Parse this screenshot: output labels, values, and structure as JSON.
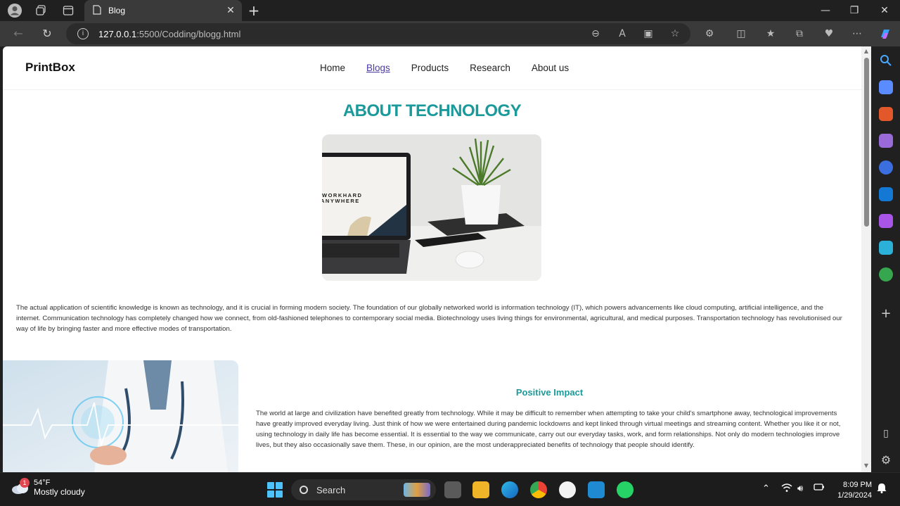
{
  "browser": {
    "tab_title": "Blog",
    "url_host": "127.0.0.1",
    "url_rest": ":5500/Codding/blogg.html"
  },
  "site": {
    "logo": "PrintBox",
    "nav": [
      {
        "label": "Home",
        "active": false
      },
      {
        "label": "Blogs",
        "active": true
      },
      {
        "label": "Products",
        "active": false
      },
      {
        "label": "Research",
        "active": false
      },
      {
        "label": "About us",
        "active": false
      }
    ],
    "title": "ABOUT TECHNOLOGY",
    "hero_image_text": [
      "WORKHARD",
      "ANYWHERE"
    ],
    "intro": "The actual application of scientific knowledge is known as technology, and it is crucial in forming modern society. The foundation of our globally networked world is information technology (IT), which powers advancements like cloud computing, artificial intelligence, and the internet. Communication technology has completely changed how we connect, from old-fashioned telephones to contemporary social media. Biotechnology uses living things for environmental, agricultural, and medical purposes. Transportation technology has revolutionised our way of life by bringing faster and more effective modes of transportation.",
    "section": {
      "title": "Positive Impact",
      "text": "The world at large and civilization have benefited greatly from technology. While it may be difficult to remember when attempting to take your child's smartphone away, technological improvements have greatly improved everyday living. Just think of how we were entertained during pandemic lockdowns and kept linked through virtual meetings and streaming content. Whether you like it or not, using technology in daily life has become essential. It is essential to the way we communicate, carry out our everyday tasks, work, and form relationships. Not only do modern technologies improve lives, but they also occasionally save them. These, in our opinion, are the most underappreciated benefits of technology that people should identify."
    }
  },
  "taskbar": {
    "weather_temp": "54°F",
    "weather_desc": "Mostly cloudy",
    "weather_badge": "1",
    "search_label": "Search",
    "time": "8:09 PM",
    "date": "1/29/2024"
  },
  "colors": {
    "accent": "#1a9a9a",
    "active_link": "#4a3aa0"
  }
}
